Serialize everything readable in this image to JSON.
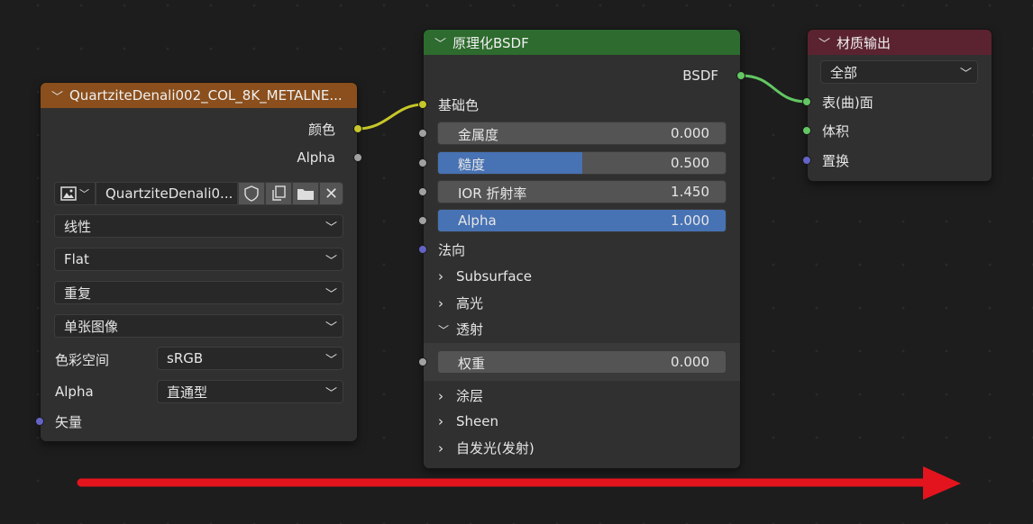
{
  "image_node": {
    "title": "QuartziteDenali002_COL_8K_METALNE...",
    "outputs": [
      "颜色",
      "Alpha"
    ],
    "image_name": "QuartziteDenali0...",
    "interpolation": "线性",
    "projection": "Flat",
    "extension": "重复",
    "source": "单张图像",
    "color_space_label": "色彩空间",
    "color_space_value": "sRGB",
    "alpha_label": "Alpha",
    "alpha_value": "直通型",
    "vector_label": "矢量",
    "header_color": "#8a4f1c"
  },
  "bsdf_node": {
    "title": "原理化BSDF",
    "output": "BSDF",
    "base_color": "基础色",
    "metallic_label": "金属度",
    "metallic_value": "0.000",
    "roughness_label": "糙度",
    "roughness_value": "0.500",
    "roughness_fraction": 0.5,
    "ior_label": "IOR 折射率",
    "ior_value": "1.450",
    "alpha_label": "Alpha",
    "alpha_value": "1.000",
    "alpha_fraction": 1.0,
    "normal_label": "法向",
    "subsurface": "Subsurface",
    "specular": "高光",
    "transmission": "透射",
    "weight_label": "权重",
    "weight_value": "0.000",
    "coat": "涂层",
    "sheen": "Sheen",
    "emission": "自发光(发射)",
    "header_color": "#2e6b2e"
  },
  "output_node": {
    "title": "材质输出",
    "target": "全部",
    "inputs": [
      "表(曲)面",
      "体积",
      "置换"
    ],
    "header_color": "#5b2330"
  },
  "colors": {
    "accent_blue": "#4772b3",
    "arrow_red": "#e3141e",
    "link_yellow": "#c7c729",
    "link_green": "#63c763"
  }
}
